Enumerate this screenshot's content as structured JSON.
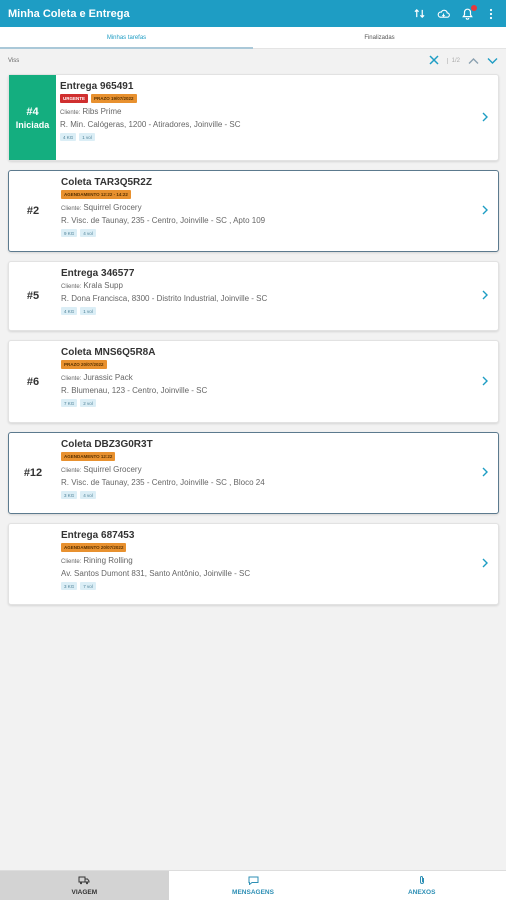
{
  "app": {
    "title": "Minha Coleta e Entrega"
  },
  "header": {
    "icons": [
      "sort-icon",
      "cloud-icon",
      "notification-icon",
      "more-icon"
    ]
  },
  "tabs": [
    {
      "label": "Minhas tarefas",
      "active": true
    },
    {
      "label": "Finalizadas",
      "active": false
    }
  ],
  "filter": {
    "label": "Viss",
    "counter": "1/2"
  },
  "cards": [
    {
      "number": "#4",
      "status": "Iniciada",
      "title": "Entrega 965491",
      "tags": [
        {
          "text": "URGENTE",
          "color": "#d02f2f"
        },
        {
          "text": "PRAZO 19/07/2022",
          "color": "#e8912f"
        }
      ],
      "client_label": "Cliente:",
      "client": "Ribs Prime",
      "address": "R. Min. Calógeras, 1200 - Atiradores, Joinville - SC",
      "chips": [
        "4 KG",
        "1 vol"
      ]
    },
    {
      "number": "#2",
      "status": "",
      "title": "Coleta TAR3Q5R2Z",
      "tags": [
        {
          "text": "AGENDAMENTO 12:22 - 14:22",
          "color": "#e8912f"
        }
      ],
      "client_label": "Cliente:",
      "client": "Squirrel Grocery",
      "address": "R. Visc. de Taunay, 235 - Centro, Joinville - SC , Apto 109",
      "chips": [
        "9 KG",
        "4 vol"
      ]
    },
    {
      "number": "#5",
      "status": "",
      "title": "Entrega 346577",
      "tags": [],
      "client_label": "Cliente:",
      "client": "Krala Supp",
      "address": "R. Dona Francisca, 8300 - Distrito Industrial, Joinville - SC",
      "chips": [
        "4 KG",
        "1 vol"
      ]
    },
    {
      "number": "#6",
      "status": "",
      "title": "Coleta MNS6Q5R8A",
      "tags": [
        {
          "text": "PRAZO 20/07/2022",
          "color": "#e8912f"
        }
      ],
      "client_label": "Cliente:",
      "client": "Jurassic Pack",
      "address": "R. Blumenau, 123 - Centro, Joinville - SC",
      "chips": [
        "7 KG",
        "2 vol"
      ]
    },
    {
      "number": "#12",
      "status": "",
      "title": "Coleta DBZ3G0R3T",
      "tags": [
        {
          "text": "AGENDAMENTO 12:22",
          "color": "#e8912f"
        }
      ],
      "client_label": "Cliente:",
      "client": "Squirrel Grocery",
      "address": "R. Visc. de Taunay, 235 - Centro, Joinville - SC , Bloco 24",
      "chips": [
        "3 KG",
        "4 vol"
      ]
    },
    {
      "number": "",
      "status": "",
      "title": "Entrega 687453",
      "tags": [
        {
          "text": "AGENDAMENTO 20/07/2022",
          "color": "#e8912f"
        }
      ],
      "client_label": "Cliente:",
      "client": "Rining Rolling",
      "address": "Av. Santos Dumont 831, Santo Antônio, Joinville - SC",
      "chips": [
        "3 KG",
        "7 vol"
      ]
    }
  ],
  "bottom_nav": [
    {
      "label": "VIAGEM",
      "icon": "truck-icon",
      "active": true
    },
    {
      "label": "MENSAGENS",
      "icon": "chat-icon",
      "active": false
    },
    {
      "label": "ANEXOS",
      "icon": "paperclip-icon",
      "active": false
    }
  ]
}
